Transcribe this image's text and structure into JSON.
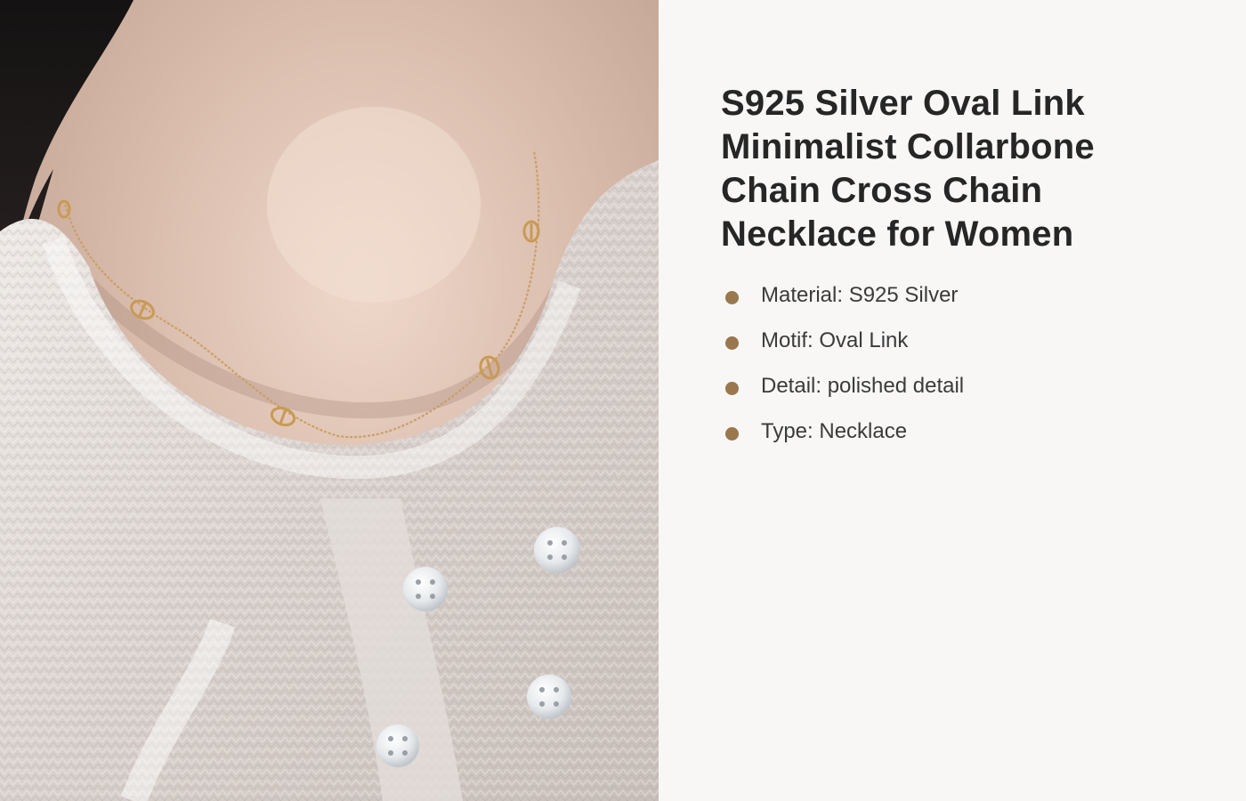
{
  "product": {
    "title": "S925 Silver Oval Link Minimalist Collarbone Chain Cross Chain Necklace for Women",
    "image_description_icon": "necklace-photo",
    "specs": [
      {
        "label": "Material: S925 Silver"
      },
      {
        "label": "Motif: Oval Link"
      },
      {
        "label": "Detail: polished detail"
      },
      {
        "label": "Type: Necklace"
      }
    ]
  },
  "colors": {
    "accent_bullet": "#9a774d",
    "title_text": "#262626",
    "body_text": "#3b3b3b",
    "panel_background": "#f8f7f5"
  }
}
